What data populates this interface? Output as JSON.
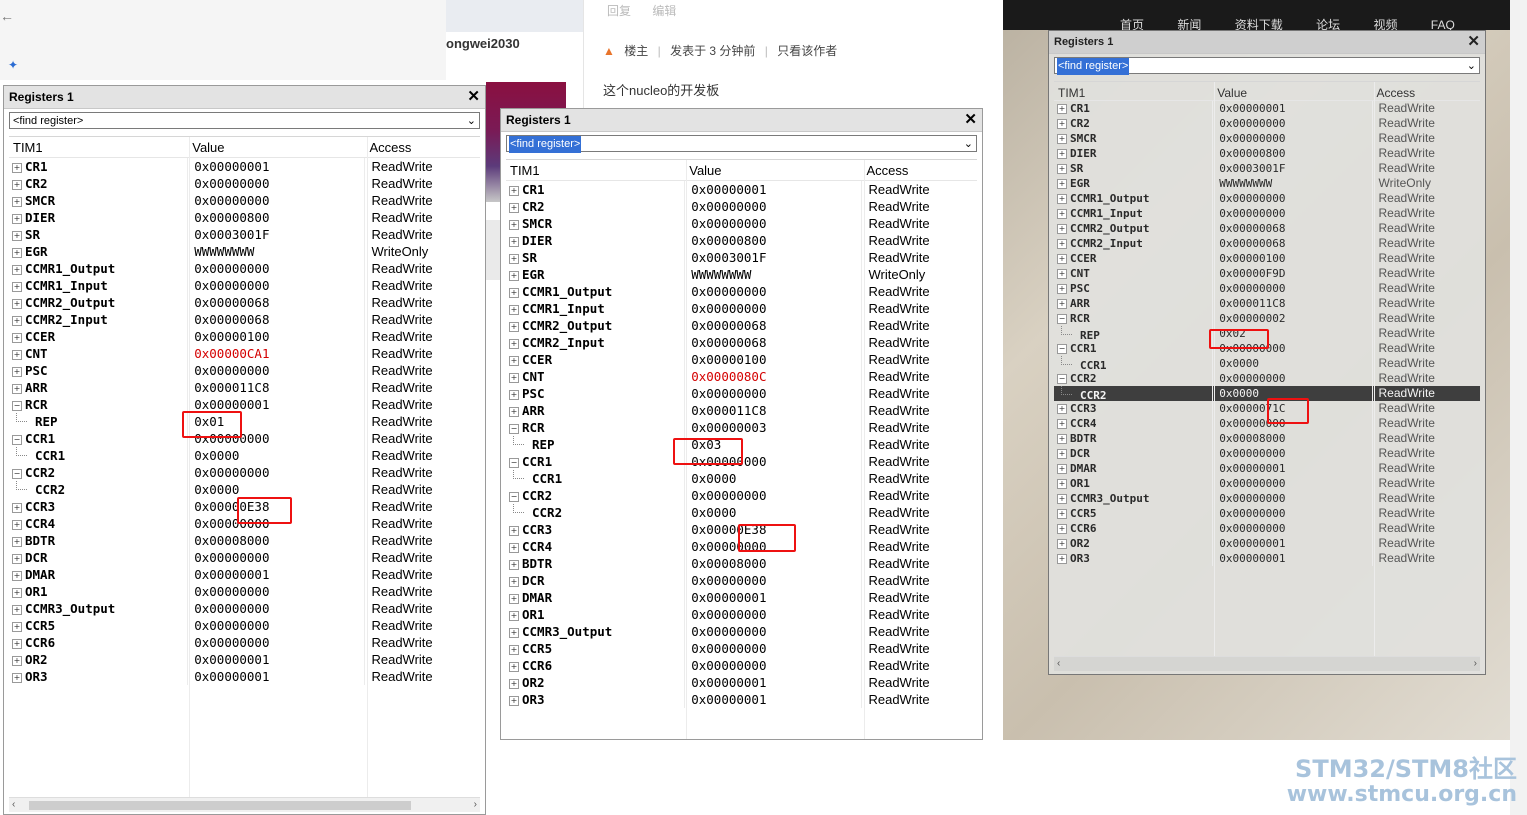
{
  "browser": {
    "back_icon": "←"
  },
  "forum": {
    "user_partial": "ongwei2030",
    "post_actions": [
      "回复",
      "编辑"
    ],
    "post_meta": {
      "role": "楼主",
      "time": "发表于 3 分钟前",
      "only_author": "只看该作者"
    },
    "post_body": "这个nucleo的开发板",
    "nav": [
      "首页",
      "新闻",
      "资料下载",
      "论坛",
      "视频",
      "FAQ"
    ]
  },
  "watermark": {
    "line1": "STM32/STM8社区",
    "line2": "www.stmcu.org.cn"
  },
  "windows": [
    {
      "title": "Registers 1",
      "find_placeholder": "<find register>",
      "columns": [
        "TIM1",
        "Value",
        "Access"
      ],
      "rows": [
        {
          "name": "CR1",
          "value": "0x00000001",
          "access": "ReadWrite"
        },
        {
          "name": "CR2",
          "value": "0x00000000",
          "access": "ReadWrite"
        },
        {
          "name": "SMCR",
          "value": "0x00000000",
          "access": "ReadWrite"
        },
        {
          "name": "DIER",
          "value": "0x00000800",
          "access": "ReadWrite"
        },
        {
          "name": "SR",
          "value": "0x0003001F",
          "access": "ReadWrite"
        },
        {
          "name": "EGR",
          "value": "WWWWWWWW",
          "access": "WriteOnly"
        },
        {
          "name": "CCMR1_Output",
          "value": "0x00000000",
          "access": "ReadWrite"
        },
        {
          "name": "CCMR1_Input",
          "value": "0x00000000",
          "access": "ReadWrite"
        },
        {
          "name": "CCMR2_Output",
          "value": "0x00000068",
          "access": "ReadWrite"
        },
        {
          "name": "CCMR2_Input",
          "value": "0x00000068",
          "access": "ReadWrite"
        },
        {
          "name": "CCER",
          "value": "0x00000100",
          "access": "ReadWrite"
        },
        {
          "name": "CNT",
          "value": "0x00000CA1",
          "access": "ReadWrite",
          "changed": true
        },
        {
          "name": "PSC",
          "value": "0x00000000",
          "access": "ReadWrite"
        },
        {
          "name": "ARR",
          "value": "0x000011C8",
          "access": "ReadWrite"
        },
        {
          "name": "RCR",
          "value": "0x00000001",
          "access": "ReadWrite",
          "expanded": true
        },
        {
          "name": "REP",
          "value": "0x01",
          "access": "ReadWrite",
          "child": true
        },
        {
          "name": "CCR1",
          "value": "0x00000000",
          "access": "ReadWrite",
          "expanded": true
        },
        {
          "name": "CCR1",
          "value": "0x0000",
          "access": "ReadWrite",
          "child": true
        },
        {
          "name": "CCR2",
          "value": "0x00000000",
          "access": "ReadWrite",
          "expanded": true
        },
        {
          "name": "CCR2",
          "value": "0x0000",
          "access": "ReadWrite",
          "child": true
        },
        {
          "name": "CCR3",
          "value": "0x00000E38",
          "access": "ReadWrite"
        },
        {
          "name": "CCR4",
          "value": "0x00000000",
          "access": "ReadWrite"
        },
        {
          "name": "BDTR",
          "value": "0x00008000",
          "access": "ReadWrite"
        },
        {
          "name": "DCR",
          "value": "0x00000000",
          "access": "ReadWrite"
        },
        {
          "name": "DMAR",
          "value": "0x00000001",
          "access": "ReadWrite"
        },
        {
          "name": "OR1",
          "value": "0x00000000",
          "access": "ReadWrite"
        },
        {
          "name": "CCMR3_Output",
          "value": "0x00000000",
          "access": "ReadWrite"
        },
        {
          "name": "CCR5",
          "value": "0x00000000",
          "access": "ReadWrite"
        },
        {
          "name": "CCR6",
          "value": "0x00000000",
          "access": "ReadWrite"
        },
        {
          "name": "OR2",
          "value": "0x00000001",
          "access": "ReadWrite"
        },
        {
          "name": "OR3",
          "value": "0x00000001",
          "access": "ReadWrite"
        }
      ]
    },
    {
      "title": "Registers 1",
      "find_placeholder": "<find register>",
      "columns": [
        "TIM1",
        "Value",
        "Access"
      ],
      "rows": [
        {
          "name": "CR1",
          "value": "0x00000001",
          "access": "ReadWrite"
        },
        {
          "name": "CR2",
          "value": "0x00000000",
          "access": "ReadWrite"
        },
        {
          "name": "SMCR",
          "value": "0x00000000",
          "access": "ReadWrite"
        },
        {
          "name": "DIER",
          "value": "0x00000800",
          "access": "ReadWrite"
        },
        {
          "name": "SR",
          "value": "0x0003001F",
          "access": "ReadWrite"
        },
        {
          "name": "EGR",
          "value": "WWWWWWWW",
          "access": "WriteOnly"
        },
        {
          "name": "CCMR1_Output",
          "value": "0x00000000",
          "access": "ReadWrite"
        },
        {
          "name": "CCMR1_Input",
          "value": "0x00000000",
          "access": "ReadWrite"
        },
        {
          "name": "CCMR2_Output",
          "value": "0x00000068",
          "access": "ReadWrite"
        },
        {
          "name": "CCMR2_Input",
          "value": "0x00000068",
          "access": "ReadWrite"
        },
        {
          "name": "CCER",
          "value": "0x00000100",
          "access": "ReadWrite"
        },
        {
          "name": "CNT",
          "value": "0x0000080C",
          "access": "ReadWrite",
          "changed": true
        },
        {
          "name": "PSC",
          "value": "0x00000000",
          "access": "ReadWrite"
        },
        {
          "name": "ARR",
          "value": "0x000011C8",
          "access": "ReadWrite"
        },
        {
          "name": "RCR",
          "value": "0x00000003",
          "access": "ReadWrite",
          "expanded": true
        },
        {
          "name": "REP",
          "value": "0x03",
          "access": "ReadWrite",
          "child": true
        },
        {
          "name": "CCR1",
          "value": "0x00000000",
          "access": "ReadWrite",
          "expanded": true
        },
        {
          "name": "CCR1",
          "value": "0x0000",
          "access": "ReadWrite",
          "child": true
        },
        {
          "name": "CCR2",
          "value": "0x00000000",
          "access": "ReadWrite",
          "expanded": true
        },
        {
          "name": "CCR2",
          "value": "0x0000",
          "access": "ReadWrite",
          "child": true
        },
        {
          "name": "CCR3",
          "value": "0x00000E38",
          "access": "ReadWrite"
        },
        {
          "name": "CCR4",
          "value": "0x00000000",
          "access": "ReadWrite"
        },
        {
          "name": "BDTR",
          "value": "0x00008000",
          "access": "ReadWrite"
        },
        {
          "name": "DCR",
          "value": "0x00000000",
          "access": "ReadWrite"
        },
        {
          "name": "DMAR",
          "value": "0x00000001",
          "access": "ReadWrite"
        },
        {
          "name": "OR1",
          "value": "0x00000000",
          "access": "ReadWrite"
        },
        {
          "name": "CCMR3_Output",
          "value": "0x00000000",
          "access": "ReadWrite"
        },
        {
          "name": "CCR5",
          "value": "0x00000000",
          "access": "ReadWrite"
        },
        {
          "name": "CCR6",
          "value": "0x00000000",
          "access": "ReadWrite"
        },
        {
          "name": "OR2",
          "value": "0x00000001",
          "access": "ReadWrite"
        },
        {
          "name": "OR3",
          "value": "0x00000001",
          "access": "ReadWrite"
        }
      ]
    },
    {
      "title": "Registers 1",
      "find_placeholder": "<find register>",
      "columns": [
        "TIM1",
        "Value",
        "Access"
      ],
      "rows": [
        {
          "name": "CR1",
          "value": "0x00000001",
          "access": "ReadWrite"
        },
        {
          "name": "CR2",
          "value": "0x00000000",
          "access": "ReadWrite"
        },
        {
          "name": "SMCR",
          "value": "0x00000000",
          "access": "ReadWrite"
        },
        {
          "name": "DIER",
          "value": "0x00000800",
          "access": "ReadWrite"
        },
        {
          "name": "SR",
          "value": "0x0003001F",
          "access": "ReadWrite"
        },
        {
          "name": "EGR",
          "value": "WWWWWWWW",
          "access": "WriteOnly"
        },
        {
          "name": "CCMR1_Output",
          "value": "0x00000000",
          "access": "ReadWrite"
        },
        {
          "name": "CCMR1_Input",
          "value": "0x00000000",
          "access": "ReadWrite"
        },
        {
          "name": "CCMR2_Output",
          "value": "0x00000068",
          "access": "ReadWrite"
        },
        {
          "name": "CCMR2_Input",
          "value": "0x00000068",
          "access": "ReadWrite"
        },
        {
          "name": "CCER",
          "value": "0x00000100",
          "access": "ReadWrite"
        },
        {
          "name": "CNT",
          "value": "0x00000F9D",
          "access": "ReadWrite"
        },
        {
          "name": "PSC",
          "value": "0x00000000",
          "access": "ReadWrite"
        },
        {
          "name": "ARR",
          "value": "0x000011C8",
          "access": "ReadWrite"
        },
        {
          "name": "RCR",
          "value": "0x00000002",
          "access": "ReadWrite",
          "expanded": true
        },
        {
          "name": "REP",
          "value": "0x02",
          "access": "ReadWrite",
          "child": true
        },
        {
          "name": "CCR1",
          "value": "0x00000000",
          "access": "ReadWrite",
          "expanded": true
        },
        {
          "name": "CCR1",
          "value": "0x0000",
          "access": "ReadWrite",
          "child": true
        },
        {
          "name": "CCR2",
          "value": "0x00000000",
          "access": "ReadWrite",
          "expanded": true
        },
        {
          "name": "CCR2",
          "value": "0x0000",
          "access": "ReadWrite",
          "child": true,
          "selected": true
        },
        {
          "name": "CCR3",
          "value": "0x0000071C",
          "access": "ReadWrite"
        },
        {
          "name": "CCR4",
          "value": "0x00000000",
          "access": "ReadWrite"
        },
        {
          "name": "BDTR",
          "value": "0x00008000",
          "access": "ReadWrite"
        },
        {
          "name": "DCR",
          "value": "0x00000000",
          "access": "ReadWrite"
        },
        {
          "name": "DMAR",
          "value": "0x00000001",
          "access": "ReadWrite"
        },
        {
          "name": "OR1",
          "value": "0x00000000",
          "access": "ReadWrite"
        },
        {
          "name": "CCMR3_Output",
          "value": "0x00000000",
          "access": "ReadWrite"
        },
        {
          "name": "CCR5",
          "value": "0x00000000",
          "access": "ReadWrite"
        },
        {
          "name": "CCR6",
          "value": "0x00000000",
          "access": "ReadWrite"
        },
        {
          "name": "OR2",
          "value": "0x00000001",
          "access": "ReadWrite"
        },
        {
          "name": "OR3",
          "value": "0x00000001",
          "access": "ReadWrite"
        }
      ]
    }
  ],
  "colors": {
    "changed_value": "#d40000",
    "highlight_box": "#e11111",
    "selection": "#3470d6"
  }
}
